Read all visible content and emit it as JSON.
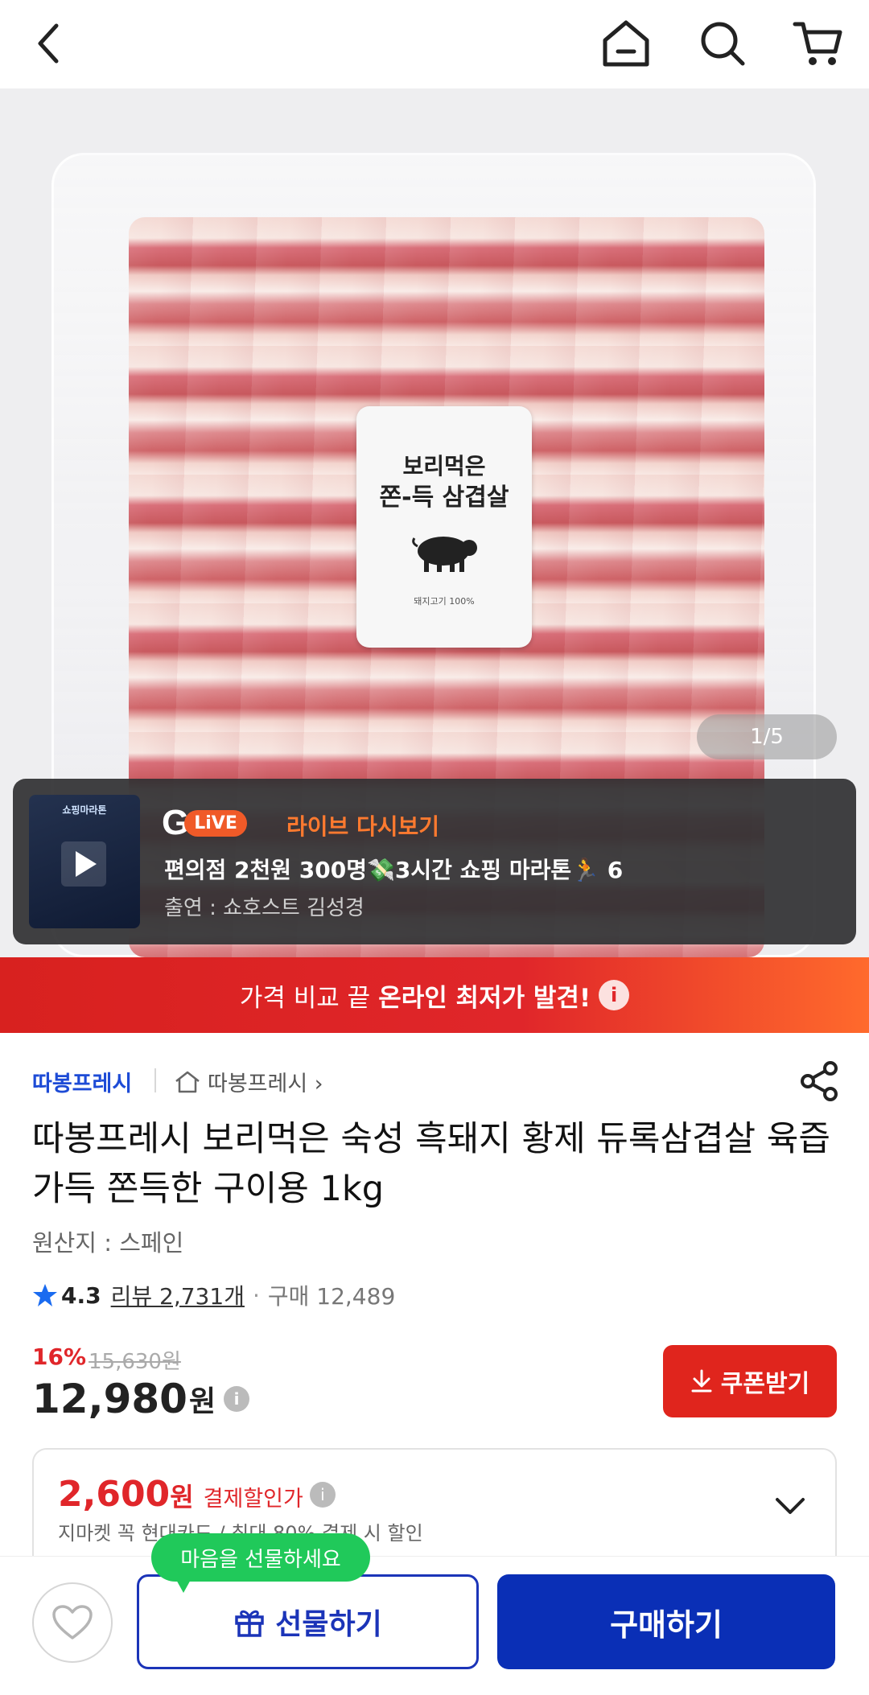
{
  "nav": {
    "icons": [
      "back-icon",
      "home-icon",
      "search-icon",
      "cart-icon"
    ]
  },
  "gallery": {
    "label_line1": "보리먹은",
    "label_line2": "쫀-득 삼겹살",
    "label_line3": "돼지고기 100%",
    "counter": "1/5"
  },
  "live": {
    "brand_letter": "G",
    "brand_pill": "LiVE",
    "title": "라이브 다시보기",
    "thumb_title": "쇼핑마라톤",
    "line1": "편의점 2천원 300명💸3시간 쇼핑 마라톤🏃 6",
    "line2": "출연 : 쇼호스트 김성경"
  },
  "promo": {
    "text_normal": "가격 비교 끝",
    "text_bold": "온라인 최저가 발견!",
    "info": "i"
  },
  "seller": {
    "name": "따봉프레시",
    "store": "따봉프레시 ›"
  },
  "product": {
    "title": "따봉프레시 보리먹은 숙성 흑돼지 황제 듀록삼겹살 육즙가득 쫀득한 구이용 1kg",
    "origin": "원산지 : 스페인",
    "rating": "4.3",
    "reviews": "리뷰 2,731개",
    "dot": "·",
    "purchases": "구매 12,489"
  },
  "price": {
    "discount": "16%",
    "original": "15,630원",
    "value": "12,980",
    "unit": "원",
    "info": "i",
    "coupon_label": "쿠폰받기"
  },
  "payment": {
    "amount": "2,600",
    "unit": "원",
    "label": "결제할인가",
    "info": "i",
    "sub": "지마켓 꼭 현대카드 / 최대 80% 결제 시 할인"
  },
  "bottom": {
    "tooltip": "마음을 선물하세요",
    "gift_label": "선물하기",
    "buy_label": "구매하기"
  },
  "colors": {
    "accent_red": "#e0262a",
    "brand_blue": "#0a2fb6",
    "live_orange": "#ff7a2f",
    "tooltip_green": "#20c95a"
  }
}
